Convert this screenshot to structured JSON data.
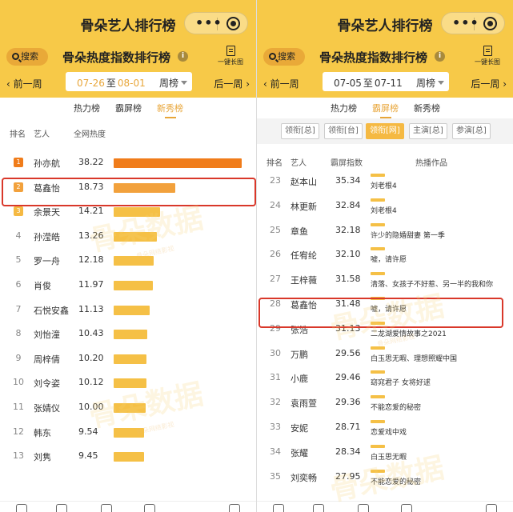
{
  "app_title": "骨朵艺人排行榜",
  "capsule": {
    "more": "•••"
  },
  "header": {
    "search_label": "搜索",
    "page_heading": "骨朵热度指数排行榜",
    "info_glyph": "i",
    "long_image_label": "一键长图",
    "prev_label": "前一周",
    "next_label": "后一周",
    "to_label": "至",
    "unit_label": "周榜"
  },
  "tabs": [
    "热力榜",
    "霸屏榜",
    "新秀榜"
  ],
  "left": {
    "start_date": "07-26",
    "end_date": "08-01",
    "active_tab": 2,
    "columns": {
      "rank": "排名",
      "artist": "艺人",
      "metric": "全网热度"
    },
    "rows": [
      {
        "rank": "1",
        "name": "孙亦航",
        "value": 38.22,
        "value_label": "38.22"
      },
      {
        "rank": "2",
        "name": "葛鑫怡",
        "value": 18.73,
        "value_label": "18.73"
      },
      {
        "rank": "3",
        "name": "余景天",
        "value": 14.21,
        "value_label": "14.21"
      },
      {
        "rank": "4",
        "name": "孙滢皓",
        "value": 13.26,
        "value_label": "13.26"
      },
      {
        "rank": "5",
        "name": "罗一舟",
        "value": 12.18,
        "value_label": "12.18"
      },
      {
        "rank": "6",
        "name": "肖俊",
        "value": 11.97,
        "value_label": "11.97"
      },
      {
        "rank": "7",
        "name": "石悦安鑫",
        "value": 11.13,
        "value_label": "11.13"
      },
      {
        "rank": "8",
        "name": "刘怡潼",
        "value": 10.43,
        "value_label": "10.43"
      },
      {
        "rank": "9",
        "name": "周梓倩",
        "value": 10.2,
        "value_label": "10.20"
      },
      {
        "rank": "10",
        "name": "刘令姿",
        "value": 10.12,
        "value_label": "10.12"
      },
      {
        "rank": "11",
        "name": "张婧仪",
        "value": 10.0,
        "value_label": "10.00"
      },
      {
        "rank": "12",
        "name": "韩东",
        "value": 9.54,
        "value_label": "9.54"
      },
      {
        "rank": "13",
        "name": "刘隽",
        "value": 9.45,
        "value_label": "9.45"
      }
    ],
    "highlight_rank": "2"
  },
  "right": {
    "start_date": "07-05",
    "end_date": "07-11",
    "active_tab": 1,
    "filters": [
      "领衔[总]",
      "领衔[台]",
      "领衔[网]",
      "主演[总]",
      "参演[总]"
    ],
    "active_filter": 2,
    "columns": {
      "rank": "排名",
      "artist": "艺人",
      "metric": "霸屏指数",
      "works": "热播作品"
    },
    "rows": [
      {
        "rank": "23",
        "name": "赵本山",
        "value_label": "35.34",
        "work": "刘老根4"
      },
      {
        "rank": "24",
        "name": "林更新",
        "value_label": "32.84",
        "work": "刘老根4"
      },
      {
        "rank": "25",
        "name": "章鱼",
        "value_label": "32.18",
        "work": "许少的隐婚甜妻 第一季"
      },
      {
        "rank": "26",
        "name": "任宥纶",
        "value_label": "32.10",
        "work": "嘘，请许愿"
      },
      {
        "rank": "27",
        "name": "王梓薇",
        "value_label": "31.58",
        "work": "清落、女孩子不好惹、另一半的我和你"
      },
      {
        "rank": "28",
        "name": "葛鑫怡",
        "value_label": "31.48",
        "work": "嘘，请许愿"
      },
      {
        "rank": "29",
        "name": "张浩",
        "value_label": "31.13",
        "work": "二龙湖爱情故事之2021"
      },
      {
        "rank": "30",
        "name": "万鹏",
        "value_label": "29.56",
        "work": "白玉思无暇、理想照耀中国"
      },
      {
        "rank": "31",
        "name": "小鹿",
        "value_label": "29.46",
        "work": "窈窕君子 女将好逑"
      },
      {
        "rank": "32",
        "name": "袁雨萱",
        "value_label": "29.36",
        "work": "不能恋爱的秘密"
      },
      {
        "rank": "33",
        "name": "安妮",
        "value_label": "28.71",
        "work": "恋爱戏中戏"
      },
      {
        "rank": "34",
        "name": "张耀",
        "value_label": "28.34",
        "work": "白玉思无暇"
      },
      {
        "rank": "35",
        "name": "刘奕畅",
        "value_label": "27.95",
        "work": "不能恋爱的秘密"
      }
    ],
    "highlight_rank": "28"
  },
  "watermark": {
    "text": "骨朵数据",
    "sub": "骨朵网络影视"
  },
  "colors": {
    "header_bg": "#f7c948",
    "accent": "#e8a63a",
    "bar_top": "#f07c1a",
    "bar_mid": "#f2a13c",
    "bar": "#f5c046",
    "highlight_border": "#d9382a"
  }
}
